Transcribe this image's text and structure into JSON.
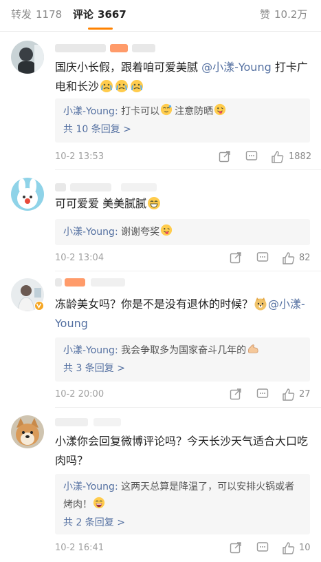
{
  "tabs": [
    {
      "label": "转发",
      "count": "1178"
    },
    {
      "label": "评论",
      "count": "3667"
    },
    {
      "label": "赞",
      "count": "10.2万"
    }
  ],
  "comments": [
    {
      "text_a": "国庆小长假，跟着咱可爱美腻 ",
      "mention": "@小漾-Young",
      "text_b": " 打卡广电和长沙",
      "reply_name": "小漾-Young:",
      "reply_text": " 打卡可以",
      "reply_text2": "注意防晒",
      "more": "共 10 条回复 >",
      "time": "10-2 13:53",
      "likes": "1882"
    },
    {
      "text_a": "可可爱爱 美美腻腻",
      "reply_name": "小漾-Young:",
      "reply_text": " 谢谢夸奖",
      "time": "10-2 13:04",
      "likes": "82"
    },
    {
      "text_a": "冻龄美女吗？你是不是没有退休的时候？",
      "mention": "@小漾-Young",
      "reply_name": "小漾-Young:",
      "reply_text": " 我会争取多为国家奋斗几年的",
      "more": "共 3 条回复 >",
      "time": "10-2 20:00",
      "likes": "27"
    },
    {
      "text_a": "小漾你会回复微博评论吗？今天长沙天气适合大口吃肉吗？",
      "reply_name": "小漾-Young:",
      "reply_text": " 这两天总算是降温了，可以安排火锅或者烤肉！",
      "more": "共 2 条回复 >",
      "time": "10-2 16:41",
      "likes": "10"
    }
  ],
  "icons": {
    "share": "share-icon",
    "comment": "comment-icon",
    "like": "thumbs-up-icon"
  },
  "colors": {
    "accent": "#ff8200",
    "link": "#5470a1",
    "reply_bg": "#f6f6f6"
  }
}
